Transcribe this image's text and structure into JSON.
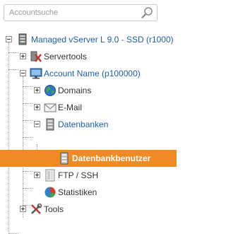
{
  "search": {
    "placeholder": "Accountsuche",
    "value": ""
  },
  "tree": {
    "root": {
      "label": "Managed vServer L 9.0 - SSD (r1000)",
      "icon": "server-icon"
    },
    "servertools": {
      "label": "Servertools",
      "icon": "servertools-icon"
    },
    "account": {
      "label": "Account Name (p100000)",
      "icon": "monitor-icon"
    },
    "domains": {
      "label": "Domains",
      "icon": "globe-icon"
    },
    "email": {
      "label": "E-Mail",
      "icon": "envelope-icon"
    },
    "datenbanken": {
      "label": "Datenbanken",
      "icon": "database-icon"
    },
    "datenbankbenutzer": {
      "label": "Datenbankbenutzer",
      "icon": "database-user-icon"
    },
    "ftp": {
      "label": "FTP / SSH",
      "icon": "folder-icon"
    },
    "statistiken": {
      "label": "Statistiken",
      "icon": "pie-chart-icon"
    },
    "tools": {
      "label": "Tools",
      "icon": "tools-icon"
    }
  },
  "colors": {
    "selected_bg": "#f08a24",
    "link_blue": "#1f5fa8",
    "text": "#333333"
  }
}
